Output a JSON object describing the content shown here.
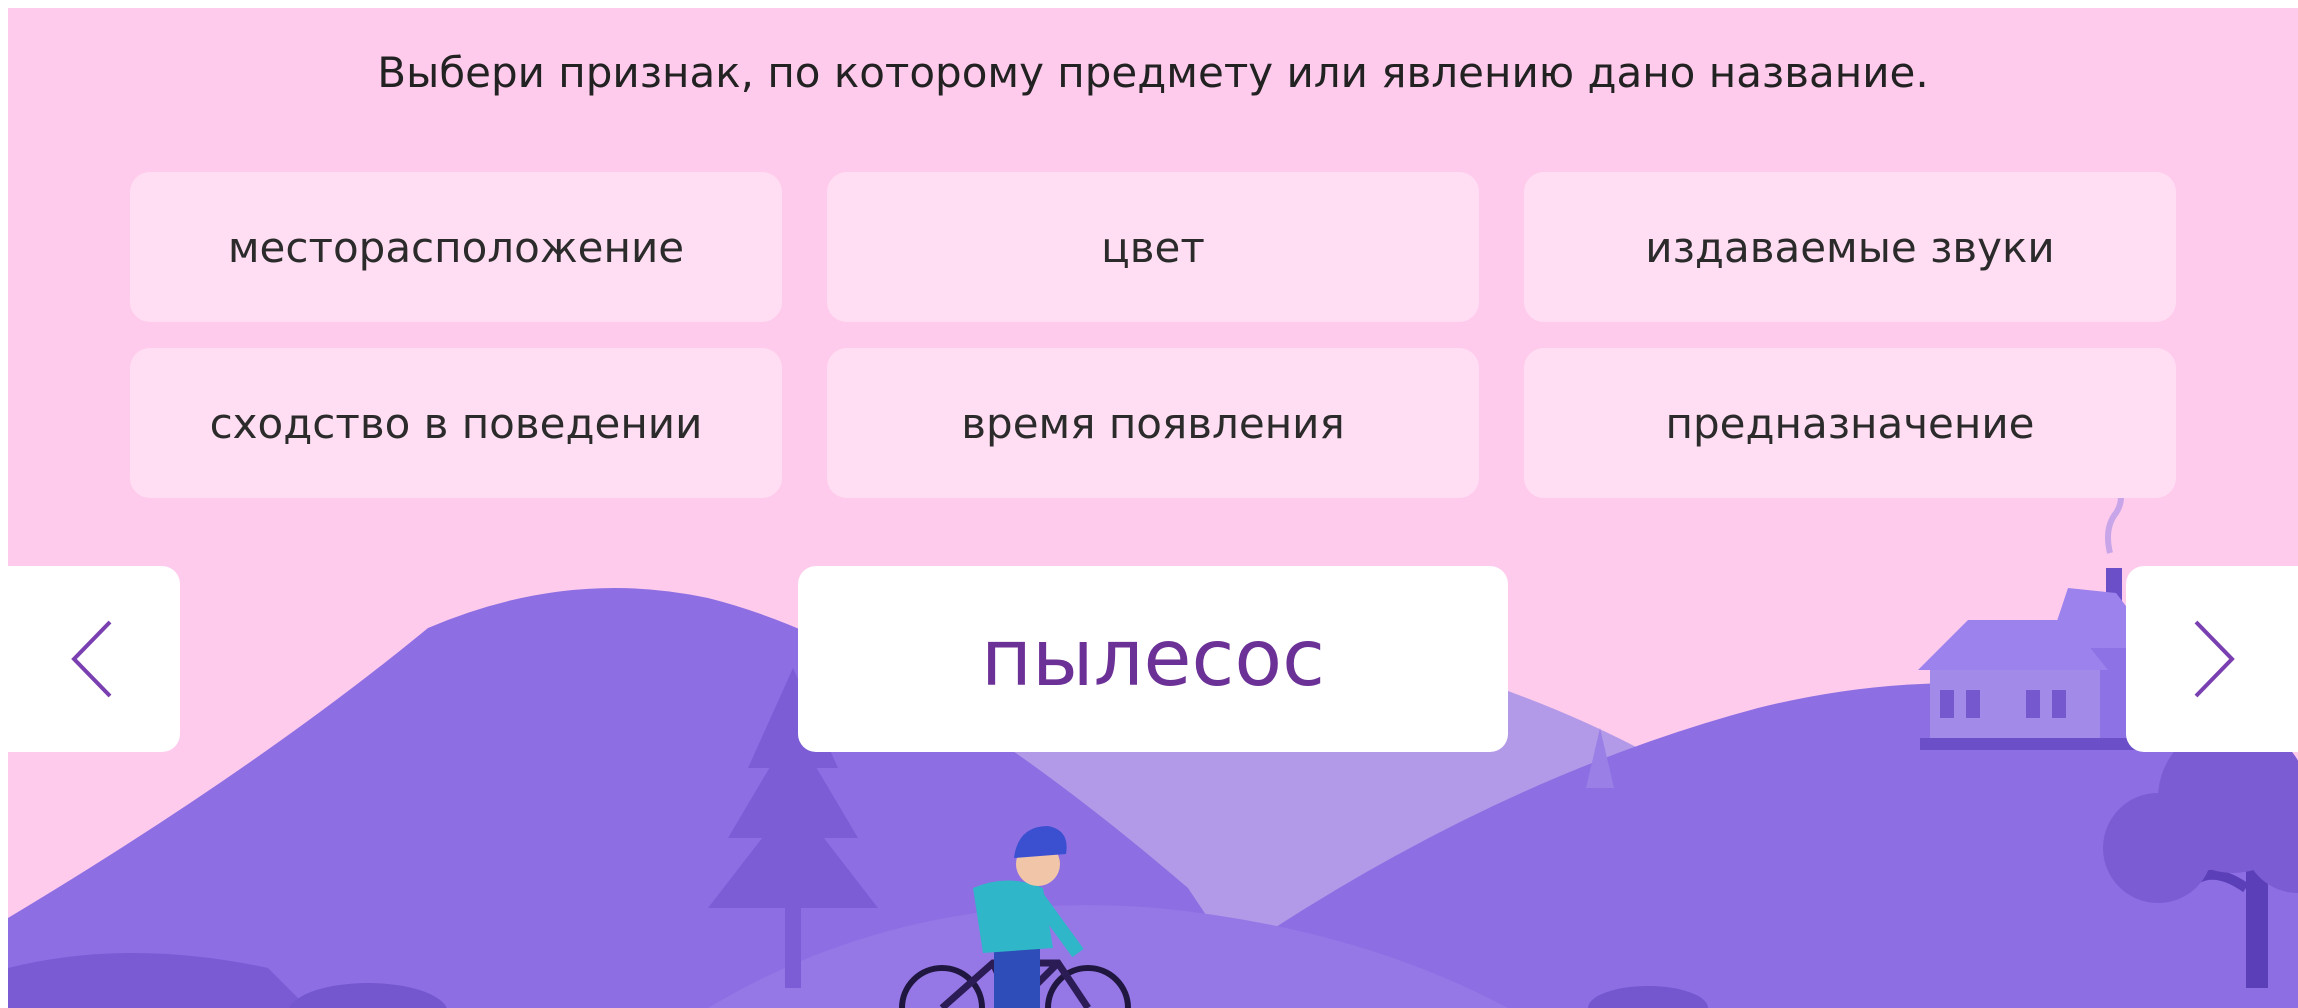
{
  "task": {
    "prompt": "Выбери признак, по которому предмету или явлению дано название."
  },
  "options": [
    "месторасположение",
    "цвет",
    "издаваемые звуки",
    "сходство в поведении",
    "время появления",
    "предназначение"
  ],
  "card": {
    "word": "пылесос"
  },
  "navigation": {
    "prev_icon": "chevron-left-icon",
    "next_icon": "chevron-right-icon"
  },
  "colors": {
    "background": "#fecbec",
    "option_background": "#ffdef3",
    "word_color": "#6b3196",
    "hills": "#8d6ee3"
  }
}
